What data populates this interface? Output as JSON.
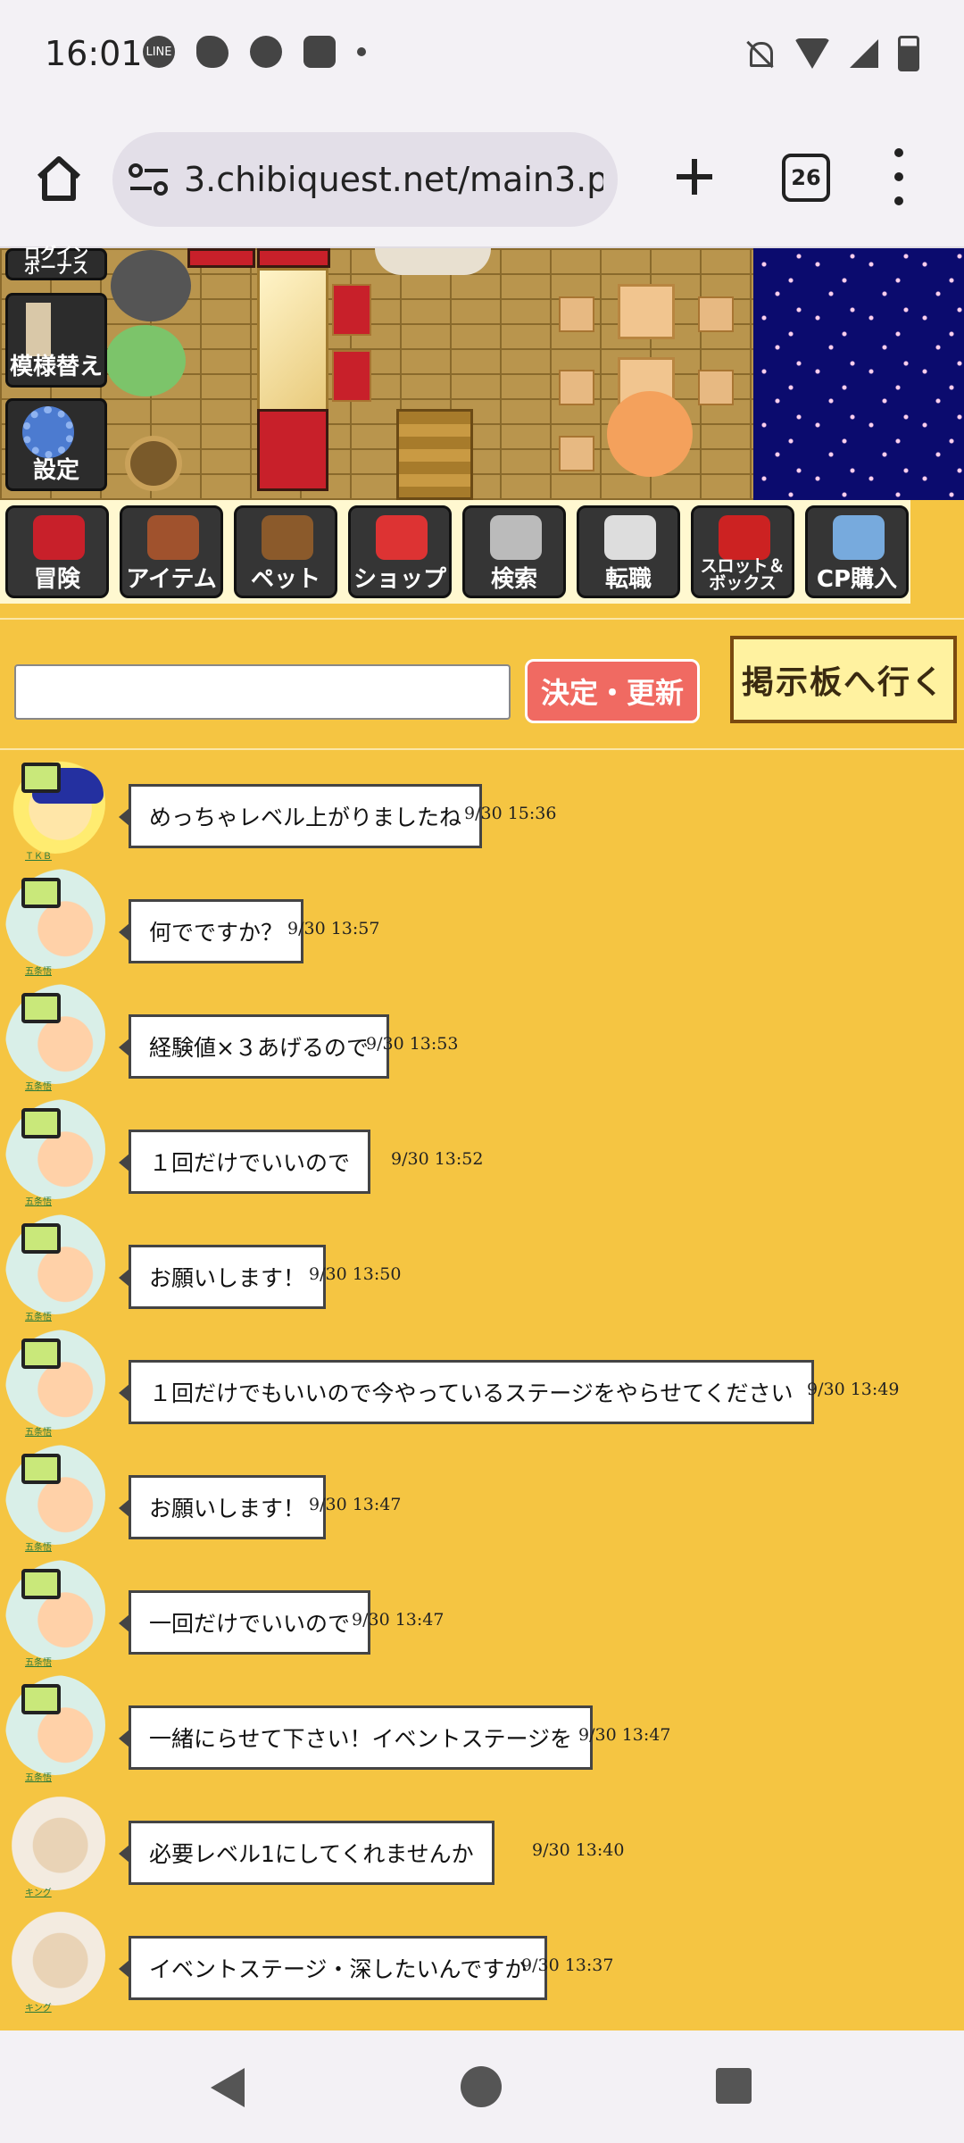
{
  "status_bar": {
    "time": "16:01",
    "left_icons": [
      "line-icon",
      "carrot-icon",
      "globe-icon",
      "gamepad-icon",
      "dot-icon"
    ],
    "line_label": "LINE",
    "right_icons": [
      "mute-icon",
      "wifi-icon",
      "signal-icon",
      "battery-icon"
    ]
  },
  "browser": {
    "url": "3.chibiquest.net/main3.p",
    "tab_count": "26"
  },
  "scene": {
    "login_bonus_label": "ログイン\nボーナス",
    "pattern_label": "模様替え",
    "settings_label": "設定"
  },
  "menu": {
    "items": [
      {
        "label": "冒険",
        "icon": "door-icon",
        "color": "#c8202a"
      },
      {
        "label": "アイテム",
        "icon": "bag-icon",
        "color": "#a0522d"
      },
      {
        "label": "ペット",
        "icon": "cat-icon",
        "color": "#8b5a2b"
      },
      {
        "label": "ショップ",
        "icon": "house-icon",
        "color": "#d33"
      },
      {
        "label": "検索",
        "icon": "magnifier-icon",
        "color": "#bbb"
      },
      {
        "label": "転職",
        "icon": "sword-staff-icon",
        "color": "#ddd"
      },
      {
        "label": "スロット＆\nボックス",
        "icon": "slot-machine-icon",
        "color": "#c22"
      },
      {
        "label": "CP購入",
        "icon": "cp-star-icon",
        "color": "#7ad"
      }
    ]
  },
  "chat": {
    "input_value": "",
    "submit_label": "決定・更新",
    "board_label": "掲示板へ行く",
    "messages": [
      {
        "user": "ＴＫＢ",
        "avatar": "tkb",
        "text": "めっちゃレベル上がりましたね",
        "time": "9/30 15:36"
      },
      {
        "user": "五条悟",
        "avatar": "gojo",
        "text": "何でですか？",
        "time": "9/30 13:57"
      },
      {
        "user": "五条悟",
        "avatar": "gojo",
        "text": "経験値×３あげるので",
        "time": "9/30 13:53"
      },
      {
        "user": "五条悟",
        "avatar": "gojo",
        "text": "１回だけでいいので",
        "time": "9/30 13:52"
      },
      {
        "user": "五条悟",
        "avatar": "gojo",
        "text": "お願いします！",
        "time": "9/30 13:50"
      },
      {
        "user": "五条悟",
        "avatar": "gojo",
        "text": "１回だけでもいいので今やっているステージをやらせてください",
        "time": "9/30 13:49"
      },
      {
        "user": "五条悟",
        "avatar": "gojo",
        "text": "お願いします！",
        "time": "9/30 13:47"
      },
      {
        "user": "五条悟",
        "avatar": "gojo",
        "text": "一回だけでいいので",
        "time": "9/30 13:47"
      },
      {
        "user": "五条悟",
        "avatar": "gojo",
        "text": "一緒にらせて下さい！イベントステージを",
        "time": "9/30 13:47"
      },
      {
        "user": "キング",
        "avatar": "king",
        "text": "必要レベル1にしてくれませんか",
        "time": "9/30 13:40"
      },
      {
        "user": "キング",
        "avatar": "king",
        "text": "イベントステージ・深したいんですか",
        "time": "9/30 13:37"
      }
    ]
  },
  "colors": {
    "page_bg": "#f5c542",
    "submit_bg": "#f06a62",
    "board_bg": "#fff2a0"
  }
}
